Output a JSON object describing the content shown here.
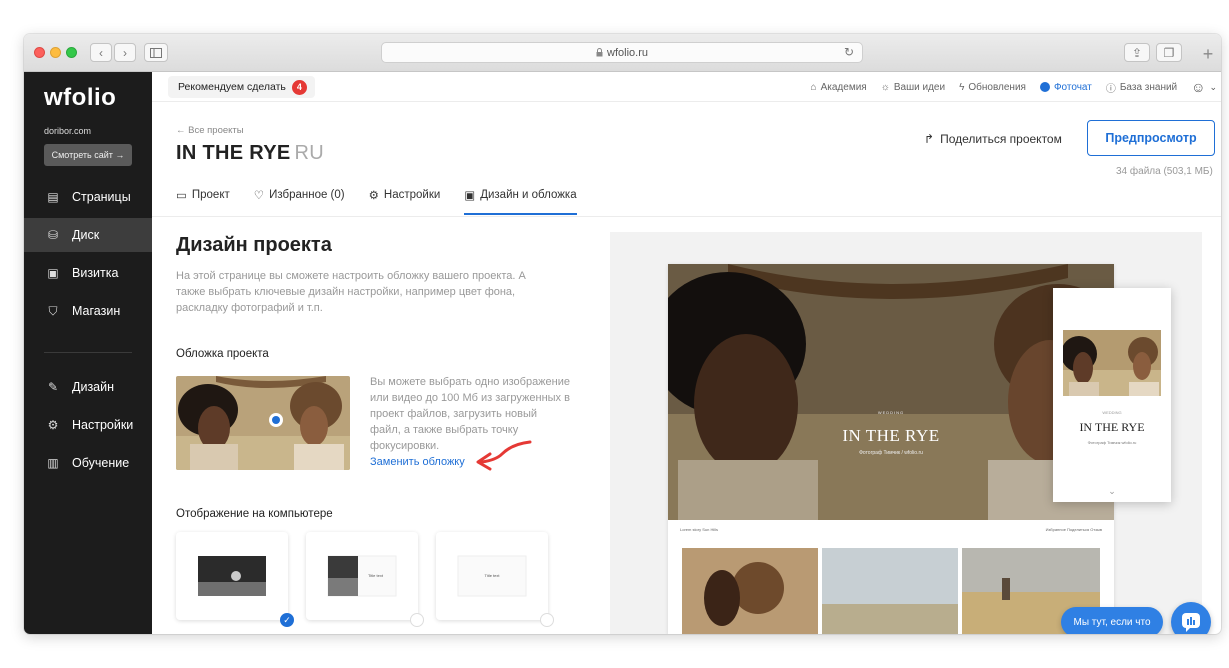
{
  "browser": {
    "url": "wfolio.ru",
    "lock_icon": "lock-icon",
    "reload_icon": "reload-icon"
  },
  "sidebar": {
    "logo": "wfolio",
    "domain": "doribor.com",
    "view_site": "Смотреть сайт →",
    "items": [
      {
        "label": "Страницы",
        "icon": "page-icon",
        "active": false
      },
      {
        "label": "Диск",
        "icon": "disk-icon",
        "active": true
      },
      {
        "label": "Визитка",
        "icon": "card-icon",
        "active": false
      },
      {
        "label": "Магазин",
        "icon": "cart-icon",
        "active": false
      },
      {
        "label": "Дизайн",
        "icon": "brush-icon",
        "active": false
      },
      {
        "label": "Настройки",
        "icon": "gear-icon",
        "active": false
      },
      {
        "label": "Обучение",
        "icon": "book-icon",
        "active": false
      }
    ]
  },
  "topbar": {
    "recommend_label": "Рекомендуем сделать",
    "recommend_count": "4",
    "links": {
      "academy": "Академия",
      "ideas": "Ваши идеи",
      "updates": "Обновления",
      "photochat": "Фоточат",
      "knowledge": "База знаний"
    }
  },
  "project": {
    "back": "← Все проекты",
    "title": "IN THE RYE",
    "lang": "RU",
    "share": "Поделиться проектом",
    "preview": "Предпросмотр",
    "files": "34 файла (503,1 МБ)",
    "tabs": {
      "project": "Проект",
      "favorites": "Избранное (0)",
      "settings": "Настройки",
      "design": "Дизайн и обложка"
    }
  },
  "design": {
    "heading": "Дизайн проекта",
    "description": "На этой странице вы сможете настроить обложку вашего проекта. А также выбрать ключевые дизайн настройки, например цвет фона, раскладку фотографий и т.п.",
    "cover_heading": "Обложка проекта",
    "cover_text": "Вы можете выбрать одно изображение или видео до 100 Мб из загруженных в проект файлов, загрузить новый файл, а также выбрать точку фокусировки.",
    "replace_cover": "Заменить обложку",
    "desktop_heading": "Отображение на компьютере",
    "layout_options": [
      {
        "label": "",
        "selected": true
      },
      {
        "label": "Title text",
        "selected": false
      },
      {
        "label": "Title text",
        "selected": false
      }
    ]
  },
  "preview_mock": {
    "kicker": "WEDDING",
    "title": "IN THE RYE",
    "subtitle": "Фотограф Тимчик / wfolio.ru",
    "nav_left": "Lorem story   Sun   Hills",
    "nav_right": "Избранное   Поделиться   Отзыв",
    "mobile_kicker": "WEDDING",
    "mobile_title": "IN THE RYE",
    "mobile_sub": "Фотограф Тимчик wfolio.ru"
  },
  "help": {
    "pill": "Мы тут, если что"
  },
  "colors": {
    "accent": "#1f6fd6",
    "sidebar": "#1c1c1c",
    "badge": "#e53935",
    "arrow": "#e53935"
  }
}
